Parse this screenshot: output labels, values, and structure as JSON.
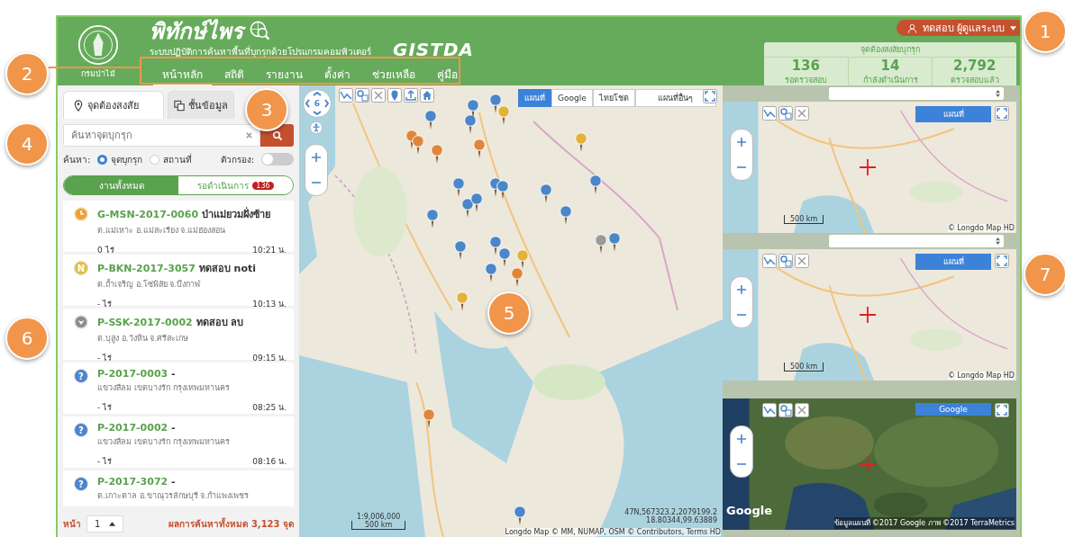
{
  "header": {
    "org_label": "กรมป่าไม้",
    "title": "พิทักษ์ไพร",
    "subtitle": "ระบบปฏิบัติการค้นหาพื้นที่บุกรุกด้วยโปรแกรมคอมพิวเตอร์",
    "partner_logo": "GISTDA",
    "nav": [
      {
        "label": "หน้าหลัก",
        "selected": true
      },
      {
        "label": "สถิติ",
        "selected": false
      },
      {
        "label": "รายงาน",
        "selected": false
      },
      {
        "label": "ตั้งค่า",
        "selected": false
      },
      {
        "label": "ช่วยเหลือ",
        "selected": false
      },
      {
        "label": "คู่มือ",
        "selected": false
      }
    ],
    "user": "ทดสอบ ผู้ดูแลระบบ",
    "stats": {
      "title": "จุดต้องสงสัยบุกรุก",
      "items": [
        {
          "value": "136",
          "label": "รอตรวจสอบ"
        },
        {
          "value": "14",
          "label": "กำลังดำเนินการ"
        },
        {
          "value": "2,792",
          "label": "ตรวจสอบแล้ว"
        }
      ]
    }
  },
  "sidebar": {
    "tabs": [
      {
        "label": "จุดต้องสงสัย",
        "selected": true
      },
      {
        "label": "ชั้นข้อมูล",
        "selected": false
      }
    ],
    "search": {
      "placeholder": "ค้นหาจุดบุกรุก"
    },
    "search_by": {
      "label": "ค้นหา:",
      "options": [
        {
          "label": "จุดบุกรุก",
          "selected": true
        },
        {
          "label": "สถานที่",
          "selected": false
        }
      ]
    },
    "filter": {
      "label": "ตัวกรอง:",
      "on": false
    },
    "segments": [
      {
        "label": "งานทั้งหมด",
        "selected": true
      },
      {
        "label": "รอดำเนินการ",
        "selected": false,
        "badge": "136"
      }
    ],
    "items": [
      {
        "kind": "clock",
        "code": "G-MSN-2017-0060",
        "name": "ป่าแม่ยวมฝั่งซ้าย",
        "location": "ต.แม่เหาะ อ.แม่สะเรียง จ.แม่ฮ่องสอน",
        "area": "0 ไร่",
        "time": "10:21 น."
      },
      {
        "kind": "letter",
        "icon_text": "N",
        "code": "P-BKN-2017-3057",
        "name": "ทดสอบ noti",
        "location": "ต.ถ้ำเจริญ อ.โซ่พิสัย จ.บึงกาฬ",
        "area": "- ไร่",
        "time": "10:13 น."
      },
      {
        "kind": "removed",
        "code": "P-SSK-2017-0002",
        "name": "ทดสอบ ลบ",
        "location": "ต.บุสูง อ.วังหิน จ.ศรีสะเกษ",
        "area": "- ไร่",
        "time": "09:15 น."
      },
      {
        "kind": "letter",
        "icon_text": "?",
        "code": "P-2017-0003",
        "name": "-",
        "location": "แขวงสีลม เขตบางรัก กรุงเทพมหานคร",
        "area": "- ไร่",
        "time": "08:25 น."
      },
      {
        "kind": "letter",
        "icon_text": "?",
        "code": "P-2017-0002",
        "name": "-",
        "location": "แขวงสีลม เขตบางรัก กรุงเทพมหานคร",
        "area": "- ไร่",
        "time": "08:16 น."
      },
      {
        "kind": "letter",
        "icon_text": "?",
        "code": "P-2017-3072",
        "name": "-",
        "location": "ต.เกาะตาล อ.ขาณุวรลักษบุรี จ.กำแพงเพชร"
      }
    ],
    "pager": {
      "label": "หน้า",
      "page": "1",
      "total": "ผลการค้นหาทั้งหมด 3,123 จุด"
    }
  },
  "map": {
    "zoom_level": "6",
    "basemaps": [
      {
        "label": "แผนที่",
        "selected": true
      },
      {
        "label": "Google",
        "selected": false
      },
      {
        "label": "ไทยโชต",
        "selected": false
      }
    ],
    "other_maps": "แผนที่อื่นๆ",
    "scale_ratio": "1:9,006,000",
    "scale": "500 km",
    "coords": "47N,567323.2,2079199.2",
    "latlon": "18.80344,99.63889",
    "attribution": "Longdo Map © MM, NUMAP, OSM © Contributors, Terms HD"
  },
  "mini_maps": [
    {
      "kind": "road",
      "has_select": true,
      "basemap": "แผนที่",
      "scale": "500 km",
      "attribution": "© Longdo Map HD"
    },
    {
      "kind": "road",
      "has_select": true,
      "basemap": "แผนที่",
      "scale": "500 km",
      "attribution": "© Longdo Map HD"
    },
    {
      "kind": "satellite",
      "has_select": false,
      "basemap": "Google",
      "logo": "Google",
      "attribution": "ข้อมูลแผนที่ ©2017 Google ภาพ ©2017 TerraMetrics"
    }
  ],
  "callouts": [
    "1",
    "2",
    "3",
    "4",
    "5",
    "6",
    "7"
  ]
}
